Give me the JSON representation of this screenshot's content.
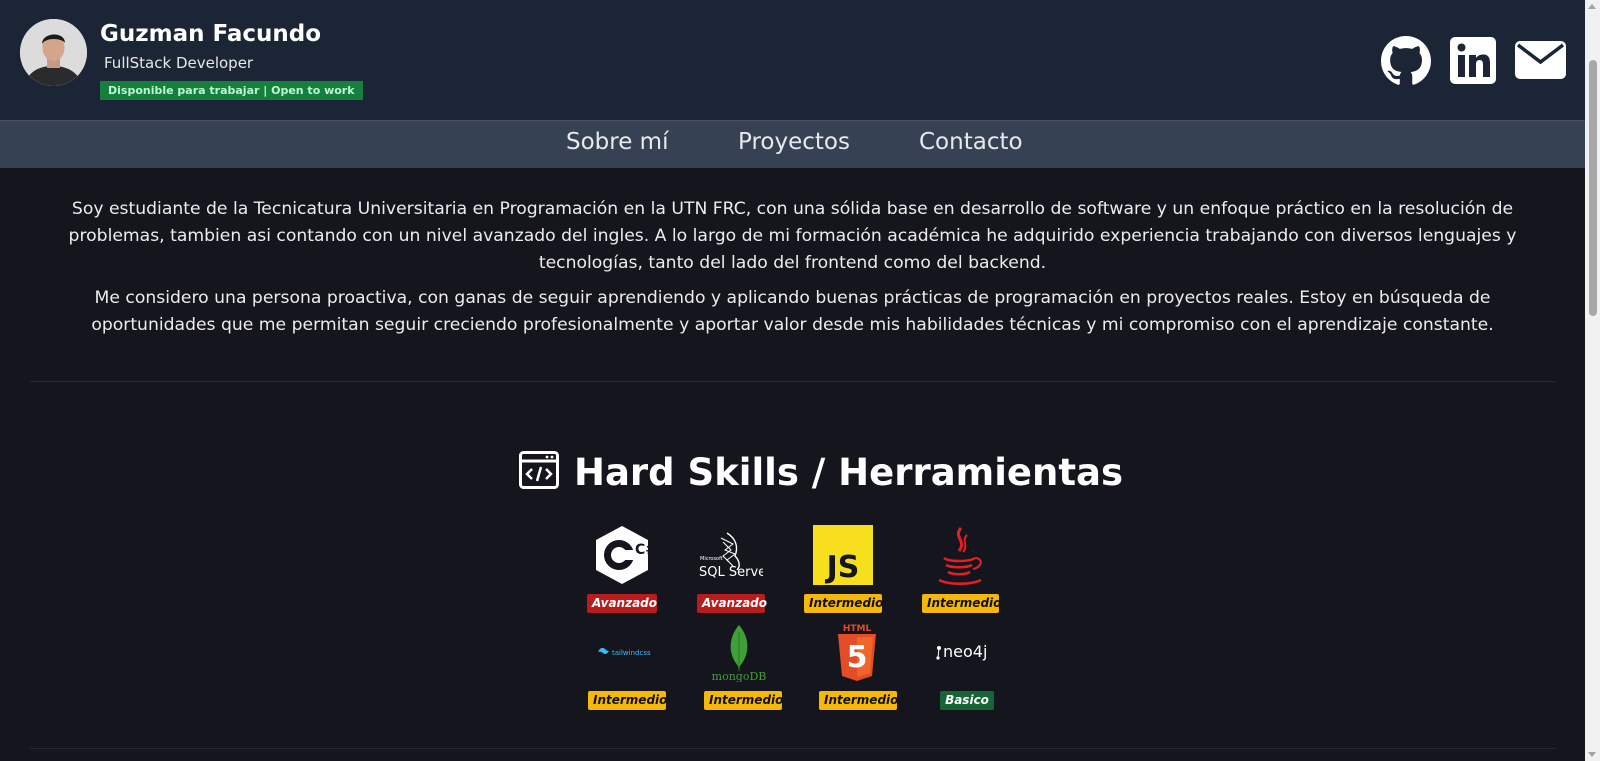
{
  "header": {
    "name": "Guzman Facundo",
    "role": "FullStack Developer",
    "status_badge": "Disponible para trabajar | Open to work",
    "social_icons": [
      "github-icon",
      "linkedin-icon",
      "email-icon"
    ]
  },
  "nav": {
    "items": [
      "Sobre mí",
      "Proyectos",
      "Contacto"
    ]
  },
  "about": {
    "paragraph_1": "Soy estudiante de la Tecnicatura Universitaria en Programación en la UTN FRC, con una sólida base en desarrollo de software y un enfoque práctico en la resolución de problemas, tambien asi contando con un nivel avanzado del ingles. A lo largo de mi formación académica he adquirido experiencia trabajando con diversos lenguajes y tecnologías, tanto del lado del frontend como del backend.",
    "paragraph_2": "Me considero una persona proactiva, con ganas de seguir aprendiendo y aplicando buenas prácticas de programación en proyectos reales. Estoy en búsqueda de oportunidades que me permitan seguir creciendo profesionalmente y aportar valor desde mis habilidades técnicas y mi compromiso con el aprendizaje constante."
  },
  "skills": {
    "title": "Hard Skills / Herramientas",
    "items": [
      {
        "logo": "csharp-logo",
        "logo_text": "C#",
        "level": "Avanzado"
      },
      {
        "logo": "sqlserver-logo",
        "logo_text": "SQL Server",
        "logo_small_text": "Microsoft",
        "level": "Avanzado"
      },
      {
        "logo": "javascript-logo",
        "logo_text": "JS",
        "level": "Intermedio"
      },
      {
        "logo": "java-logo",
        "level": "Intermedio"
      },
      {
        "logo": "tailwindcss-logo",
        "logo_text": "tailwindcss",
        "level": "Intermedio"
      },
      {
        "logo": "mongodb-logo",
        "logo_text": "mongoDB",
        "level": "Intermedio"
      },
      {
        "logo": "html5-logo",
        "logo_text": "HTML",
        "logo_number": "5",
        "level": "Intermedio"
      },
      {
        "logo": "neo4j-logo",
        "logo_text": "neo4j",
        "level": "Basico"
      }
    ]
  },
  "colors": {
    "page_bg": "#15161d",
    "header_bg": "#1c2535",
    "nav_bg": "#364254",
    "badge_green": "#15803d",
    "level_advanced": "#b91c1c",
    "level_intermediate": "#f5b70a",
    "level_basic": "#166534"
  }
}
